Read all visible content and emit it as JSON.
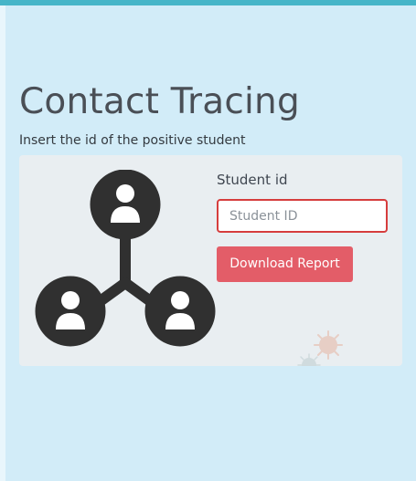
{
  "page": {
    "title": "Contact Tracing",
    "instruction": "Insert the id of the positive student"
  },
  "form": {
    "student_id_label": "Student id",
    "student_id_placeholder": "Student ID",
    "download_button_label": "Download Report"
  },
  "icons": {
    "illustration": "contact-network-icon",
    "decoration": "virus-icon"
  },
  "colors": {
    "background": "#d2ecf8",
    "top_accent": "#46b5c8",
    "card_background": "#e9eef1",
    "title_text": "#4a4f56",
    "input_border": "#d63d3d",
    "button_background": "#e35d68",
    "button_text": "#ffffff",
    "network_icon": "#303030"
  }
}
